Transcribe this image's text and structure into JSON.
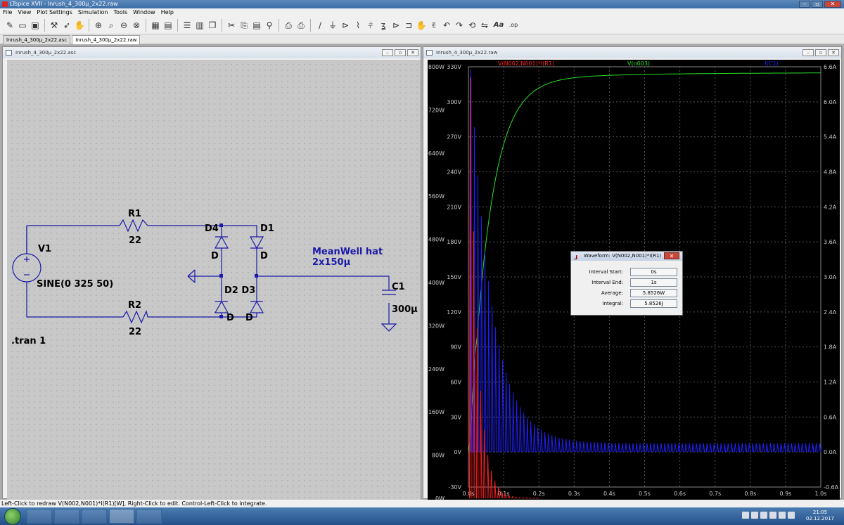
{
  "window": {
    "title": "LTspice XVII - Inrush_4_300µ_2x22.raw",
    "min": "–",
    "max": "▫",
    "close": "✕"
  },
  "menu": [
    "File",
    "View",
    "Plot Settings",
    "Simulation",
    "Tools",
    "Window",
    "Help"
  ],
  "toolbar": {
    "icons": [
      "new-schematic-icon",
      "open-icon",
      "save-icon",
      "control-panel-icon",
      "run-icon",
      "halt-icon",
      "zoom-in-icon",
      "zoom-pan-icon",
      "zoom-out-icon",
      "zoom-fit-icon",
      "autoscale-icon",
      "grid-icon",
      "tile-horizontal-icon",
      "tile-vertical-icon",
      "cascade-icon",
      "cut-icon",
      "copy-icon",
      "paste-icon",
      "find-icon",
      "print-preview-icon",
      "print-icon",
      "wire-icon",
      "ground-icon",
      "label-icon",
      "resistor-icon",
      "capacitor-icon",
      "inductor-icon",
      "diode-icon",
      "component-icon",
      "move-icon",
      "drag-icon",
      "undo-icon",
      "redo-icon",
      "rotate-icon",
      "mirror-icon",
      "text-icon",
      "spice-directive-icon"
    ],
    "text_label": "Aa",
    "op_label": ".op"
  },
  "doc_tabs": [
    "Inrush_4_300µ_2x22.asc",
    "Inrush_4_300µ_2x22.raw"
  ],
  "schematic_pane": {
    "title": "Inrush_4_300µ_2x22.asc",
    "labels": {
      "r1": "R1",
      "r1v": "22",
      "r2": "R2",
      "r2v": "22",
      "v1": "V1",
      "v1v": "SINE(0 325 50)",
      "d4": "D4",
      "d1": "D1",
      "d2d3": "D2 D3",
      "dl1": "D",
      "dl2": "D",
      "dl3": "D",
      "dl4": "D",
      "c1": "C1",
      "c1v": "300µ",
      "note": "MeanWell hat 2x150µ",
      "tran": ".tran 1"
    }
  },
  "plot_pane": {
    "title": "Inrush_4_300µ_2x22.raw",
    "traces": [
      {
        "name": "V(N002,N001)*I(R1)",
        "color": "#ff2020"
      },
      {
        "name": "V(n003)",
        "color": "#28e028"
      },
      {
        "name": "I(C1)",
        "color": "#2020ff"
      }
    ],
    "axes": {
      "x_ticks": [
        "0.0s",
        "0.1s",
        "0.2s",
        "0.3s",
        "0.4s",
        "0.5s",
        "0.6s",
        "0.7s",
        "0.8s",
        "0.9s",
        "1.0s"
      ],
      "x_range": [
        0,
        1
      ],
      "y_watts_ticks": [
        "0W",
        "80W",
        "160W",
        "240W",
        "320W",
        "400W",
        "480W",
        "560W",
        "640W",
        "720W",
        "800W"
      ],
      "y_watts_range": [
        0,
        800
      ],
      "y_volts_ticks": [
        "-30V",
        "0V",
        "30V",
        "60V",
        "90V",
        "120V",
        "150V",
        "180V",
        "210V",
        "240V",
        "270V",
        "300V",
        "330V"
      ],
      "y_volts_range": [
        -30,
        330
      ],
      "y_amps_ticks": [
        "-0.6A",
        "0.0A",
        "0.6A",
        "1.2A",
        "1.8A",
        "2.4A",
        "3.0A",
        "3.6A",
        "4.2A",
        "4.8A",
        "5.4A",
        "6.0A",
        "6.6A"
      ],
      "y_amps_range": [
        -0.6,
        6.6
      ]
    }
  },
  "waveform_dialog": {
    "title": "Waveform: V(N002,N001)*I(R1)",
    "rows": [
      {
        "label": "Interval Start:",
        "value": "0s"
      },
      {
        "label": "Interval End:",
        "value": "1s"
      },
      {
        "label": "Average:",
        "value": "5.8526W"
      },
      {
        "label": "Integral:",
        "value": "5.8526J"
      }
    ]
  },
  "status": "Left-Click to redraw V(N002,N001)*I(R1)[W],  Right-Click to edit. Control-Left-Click to integrate.",
  "taskbar": {
    "time": "21:05",
    "date": "02.12.2017"
  }
}
